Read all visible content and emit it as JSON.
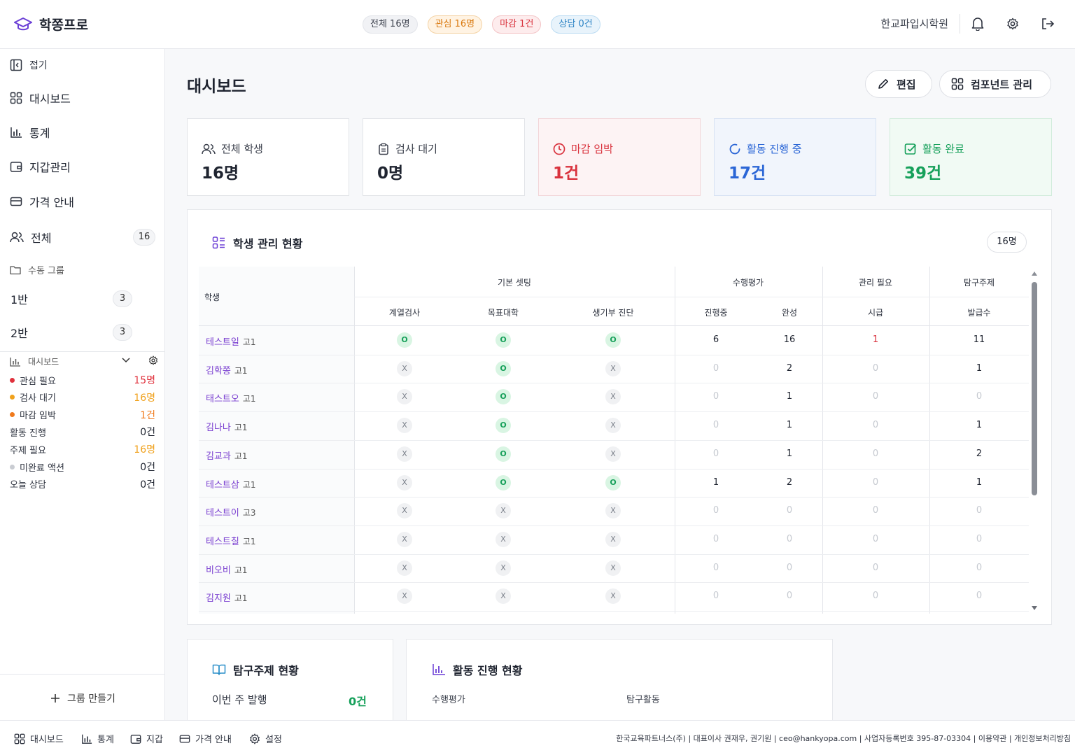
{
  "header": {
    "app_name": "학쫑프로",
    "pills": [
      {
        "label": "전체 16명",
        "tone": "gray"
      },
      {
        "label": "관심 16명",
        "tone": "orange"
      },
      {
        "label": "마감 1건",
        "tone": "red"
      },
      {
        "label": "상담 0건",
        "tone": "blue"
      }
    ],
    "academy": "한교파입시학원",
    "icons": [
      "bell-icon",
      "gear-icon",
      "logout-icon"
    ]
  },
  "sidebar": {
    "collapse": "접기",
    "nav": [
      "대시보드",
      "통계",
      "지갑관리",
      "가격 안내"
    ],
    "all_label": "전체",
    "all_count": "16",
    "manual_group_label": "수동 그룹",
    "groups": [
      {
        "label": "1반",
        "count": "3"
      },
      {
        "label": "2반",
        "count": "3"
      }
    ],
    "widget_title": "대시보드",
    "stats": [
      {
        "label": "관심 필요",
        "value": "15명",
        "dot": "#e0313c",
        "color": "#e0313c"
      },
      {
        "label": "검사 대기",
        "value": "16명",
        "dot": "#f0a11c",
        "color": "#f0a11c"
      },
      {
        "label": "마감 임박",
        "value": "1건",
        "dot": "#f07a1c",
        "color": "#f07a1c"
      },
      {
        "label": "활동 진행",
        "value": "0건",
        "dot": "",
        "color": "#1f2430"
      },
      {
        "label": "주제 필요",
        "value": "16명",
        "dot": "",
        "color": "#f0a11c"
      },
      {
        "label": "미완료 액션",
        "value": "0건",
        "dot": "#c9ccd2",
        "color": "#1f2430"
      },
      {
        "label": "오늘 상담",
        "value": "0건",
        "dot": "",
        "color": "#1f2430"
      }
    ],
    "new_group": "그룹 만들기"
  },
  "main": {
    "title": "대시보드",
    "edit_button": "편집",
    "component_button": "컴포넌트 관리",
    "cards": [
      {
        "label": "전체 학생",
        "value": "16명",
        "tone": "neutral"
      },
      {
        "label": "검사 대기",
        "value": "0명",
        "tone": "neutral"
      },
      {
        "label": "마감 임박",
        "value": "1건",
        "tone": "red"
      },
      {
        "label": "활동 진행 중",
        "value": "17건",
        "tone": "blue"
      },
      {
        "label": "활동 완료",
        "value": "39건",
        "tone": "green"
      }
    ]
  },
  "table": {
    "title": "학생 관리 현황",
    "count_chip": "16명",
    "student_header": "학생",
    "groups": [
      "기본 셋팅",
      "수행평가",
      "관리 필요",
      "탐구주제"
    ],
    "columns": [
      "계열검사",
      "목표대학",
      "생기부 진단",
      "진행중",
      "완성",
      "시급",
      "발급수"
    ],
    "rows": [
      {
        "name": "테스트일",
        "grade": "고1",
        "c1": "O",
        "c2": "O",
        "c3": "O",
        "n1": "6",
        "n2": "16",
        "n3": "1",
        "n4": "11"
      },
      {
        "name": "김학쫑",
        "grade": "고1",
        "c1": "X",
        "c2": "O",
        "c3": "X",
        "n1": "0",
        "n2": "2",
        "n3": "0",
        "n4": "1"
      },
      {
        "name": "태스트오",
        "grade": "고1",
        "c1": "X",
        "c2": "O",
        "c3": "X",
        "n1": "0",
        "n2": "1",
        "n3": "0",
        "n4": "0"
      },
      {
        "name": "김나나",
        "grade": "고1",
        "c1": "X",
        "c2": "O",
        "c3": "X",
        "n1": "0",
        "n2": "1",
        "n3": "0",
        "n4": "1"
      },
      {
        "name": "김교과",
        "grade": "고1",
        "c1": "X",
        "c2": "O",
        "c3": "X",
        "n1": "0",
        "n2": "1",
        "n3": "0",
        "n4": "2"
      },
      {
        "name": "테스트삼",
        "grade": "고1",
        "c1": "X",
        "c2": "O",
        "c3": "O",
        "n1": "1",
        "n2": "2",
        "n3": "0",
        "n4": "1"
      },
      {
        "name": "테스트이",
        "grade": "고3",
        "c1": "X",
        "c2": "X",
        "c3": "X",
        "n1": "0",
        "n2": "0",
        "n3": "0",
        "n4": "0"
      },
      {
        "name": "테스트칠",
        "grade": "고1",
        "c1": "X",
        "c2": "X",
        "c3": "X",
        "n1": "0",
        "n2": "0",
        "n3": "0",
        "n4": "0"
      },
      {
        "name": "비오비",
        "grade": "고1",
        "c1": "X",
        "c2": "X",
        "c3": "X",
        "n1": "0",
        "n2": "0",
        "n3": "0",
        "n4": "0"
      },
      {
        "name": "김지원",
        "grade": "고1",
        "c1": "X",
        "c2": "X",
        "c3": "X",
        "n1": "0",
        "n2": "0",
        "n3": "0",
        "n4": "0"
      }
    ]
  },
  "topics_panel": {
    "title": "탐구주제 현황",
    "weekly_label": "이번 주 발행",
    "weekly_value": "0건"
  },
  "activity_panel": {
    "title": "활동 진행 현황",
    "col1": "수행평가",
    "col2": "탐구활동"
  },
  "footer": {
    "nav": [
      "대시보드",
      "통계",
      "지갑",
      "가격 안내",
      "설정"
    ],
    "info": "한국교육파트너스(주) | 대표이사 권재우, 권기원 | ceo@hankyopa.com | 사업자등록번호 395-87-03304 | 이용약관 | 개인정보처리방침"
  }
}
